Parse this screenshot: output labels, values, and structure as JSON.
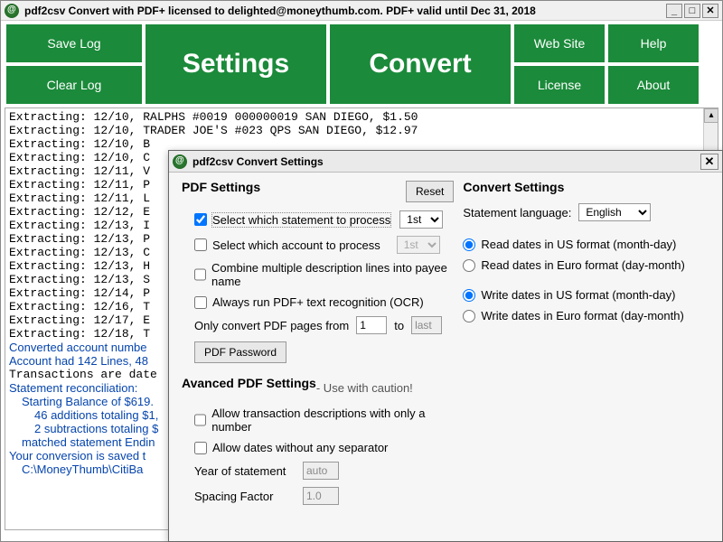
{
  "titlebar": "pdf2csv Convert with PDF+ licensed to delighted@moneythumb.com. PDF+ valid until Dec 31, 2018",
  "win": {
    "min": "_",
    "max": "□",
    "close": "✕"
  },
  "toolbar": {
    "save_log": "Save Log",
    "clear_log": "Clear Log",
    "settings": "Settings",
    "convert": "Convert",
    "web_site": "Web Site",
    "help": "Help",
    "license": "License",
    "about": "About"
  },
  "log": [
    {
      "t": "Extracting: 12/10,  RALPHS #0019 000000019 SAN DIEGO, $1.50",
      "c": "black"
    },
    {
      "t": "Extracting: 12/10,  TRADER JOE'S #023 QPS SAN DIEGO, $12.97",
      "c": "black"
    },
    {
      "t": "Extracting: 12/10,  B",
      "c": "black"
    },
    {
      "t": "Extracting: 12/10,  C",
      "c": "black"
    },
    {
      "t": "Extracting: 12/11,  V",
      "c": "black"
    },
    {
      "t": "Extracting: 12/11,  P",
      "c": "black"
    },
    {
      "t": "Extracting: 12/11,  L",
      "c": "black"
    },
    {
      "t": "Extracting: 12/12,  E",
      "c": "black"
    },
    {
      "t": "Extracting: 12/13,  I",
      "c": "black"
    },
    {
      "t": "Extracting: 12/13,  P",
      "c": "black"
    },
    {
      "t": "Extracting: 12/13,  C",
      "c": "black"
    },
    {
      "t": "Extracting: 12/13,  H",
      "c": "black"
    },
    {
      "t": "Extracting: 12/13,  S",
      "c": "black"
    },
    {
      "t": "Extracting: 12/14,  P",
      "c": "black"
    },
    {
      "t": "Extracting: 12/16,  T",
      "c": "black"
    },
    {
      "t": "Extracting: 12/17,  E",
      "c": "black"
    },
    {
      "t": "Extracting: 12/18,  T",
      "c": "black"
    },
    {
      "t": "Converted account numbe",
      "c": "blue"
    },
    {
      "t": "Account had 142 Lines, 48",
      "c": "blue"
    },
    {
      "t": "Transactions are date",
      "c": "black"
    },
    {
      "t": "Statement reconciliation:",
      "c": "blue"
    },
    {
      "t": "Starting Balance of $619.",
      "c": "blue",
      "i": 1
    },
    {
      "t": "46 additions totaling $1,",
      "c": "blue",
      "i": 2
    },
    {
      "t": "2 subtractions totaling $",
      "c": "blue",
      "i": 2
    },
    {
      "t": "matched statement Endin",
      "c": "blue",
      "i": 1
    },
    {
      "t": " ",
      "c": "black"
    },
    {
      "t": "Your conversion is saved t",
      "c": "blue"
    },
    {
      "t": "C:\\MoneyThumb\\CitiBa",
      "c": "blue",
      "i": 1
    }
  ],
  "dialog": {
    "title": "pdf2csv Convert Settings",
    "left": {
      "heading": "PDF Settings",
      "reset": "Reset",
      "cb_stmt": "Select which statement to process",
      "sel_stmt": "1st",
      "cb_acct": "Select which account to process",
      "sel_acct": "1st",
      "cb_combine": "Combine multiple description lines into payee name",
      "cb_ocr": "Always run PDF+ text recognition (OCR)",
      "pages_label": "Only convert PDF pages from",
      "pages_from": "1",
      "pages_to_label": "to",
      "pages_to": "last",
      "pdf_password": "PDF Password",
      "adv_heading": "Avanced PDF Settings",
      "adv_caution": "  - Use with caution!",
      "cb_num_only": "Allow transaction descriptions with only a number",
      "cb_no_sep": "Allow dates without any separator",
      "year_label": "Year of statement",
      "year_val": "auto",
      "spacing_label": "Spacing Factor",
      "spacing_val": "1.0"
    },
    "right": {
      "heading": "Convert Settings",
      "lang_label": "Statement language:",
      "lang_val": "English",
      "r_read_us": "Read dates in US format (month-day)",
      "r_read_eu": "Read dates in Euro format (day-month)",
      "r_write_us": "Write dates in US format (month-day)",
      "r_write_eu": "Write dates in Euro format (day-month)"
    }
  }
}
